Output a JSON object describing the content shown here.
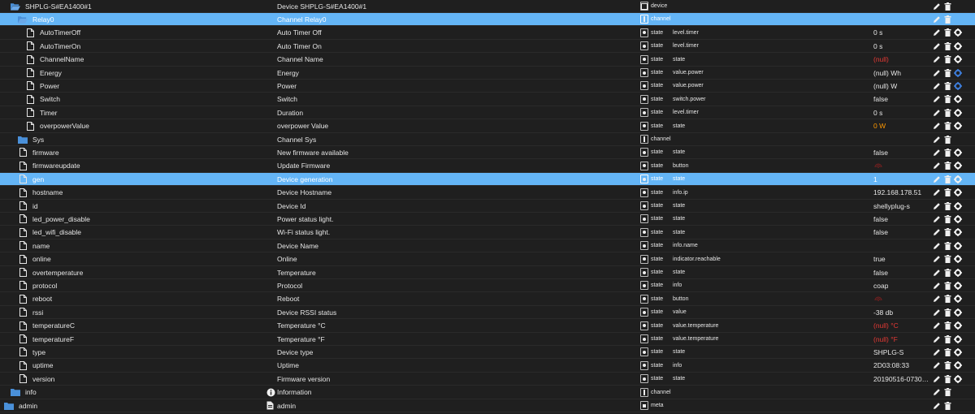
{
  "colors": {
    "background": "#1f1f1f",
    "selected_row": "#64b5f6",
    "null_value": "#e53935",
    "warn_value": "#ff9800",
    "folder": "#4a90d9"
  },
  "rows": [
    {
      "level": 0,
      "icon": "folder-open",
      "name": "SHPLG-S#EA1400#1",
      "desc": "Device SHPLG-S#EA1400#1",
      "type_icon": "device",
      "type": "device",
      "role": "",
      "value": "",
      "actions": [
        "edit",
        "delete"
      ]
    },
    {
      "level": 1,
      "icon": "folder-open",
      "name": "Relay0",
      "desc": "Channel Relay0",
      "type_icon": "channel",
      "type": "channel",
      "role": "",
      "value": "",
      "actions": [
        "edit",
        "delete"
      ],
      "selected": true
    },
    {
      "level": 2,
      "icon": "file",
      "name": "AutoTimerOff",
      "desc": "Auto Timer Off",
      "type_icon": "state",
      "type": "state",
      "role": "level.timer",
      "value": "0 s",
      "actions": [
        "edit",
        "delete",
        "gear"
      ]
    },
    {
      "level": 2,
      "icon": "file",
      "name": "AutoTimerOn",
      "desc": "Auto Timer On",
      "type_icon": "state",
      "type": "state",
      "role": "level.timer",
      "value": "0 s",
      "actions": [
        "edit",
        "delete",
        "gear"
      ]
    },
    {
      "level": 2,
      "icon": "file",
      "name": "ChannelName",
      "desc": "Channel Name",
      "type_icon": "state",
      "type": "state",
      "role": "state",
      "value": "(null)",
      "value_color": "red",
      "actions": [
        "edit",
        "delete",
        "gear"
      ]
    },
    {
      "level": 2,
      "icon": "file",
      "name": "Energy",
      "desc": "Energy",
      "type_icon": "state",
      "type": "state",
      "role": "value.power",
      "value": "(null) Wh",
      "actions": [
        "edit",
        "delete",
        "gear-blue"
      ]
    },
    {
      "level": 2,
      "icon": "file",
      "name": "Power",
      "desc": "Power",
      "type_icon": "state",
      "type": "state",
      "role": "value.power",
      "value": "(null) W",
      "actions": [
        "edit",
        "delete",
        "gear-blue"
      ]
    },
    {
      "level": 2,
      "icon": "file",
      "name": "Switch",
      "desc": "Switch",
      "type_icon": "state",
      "type": "state",
      "role": "switch.power",
      "value": "false",
      "actions": [
        "edit",
        "delete",
        "gear"
      ]
    },
    {
      "level": 2,
      "icon": "file",
      "name": "Timer",
      "desc": "Duration",
      "type_icon": "state",
      "type": "state",
      "role": "level.timer",
      "value": "0 s",
      "actions": [
        "edit",
        "delete",
        "gear"
      ]
    },
    {
      "level": 2,
      "icon": "file",
      "name": "overpowerValue",
      "desc": "overpower Value",
      "type_icon": "state",
      "type": "state",
      "role": "state",
      "value": "0 W",
      "value_color": "orange",
      "actions": [
        "edit",
        "delete",
        "gear"
      ]
    },
    {
      "level": 1,
      "icon": "folder",
      "name": "Sys",
      "desc": "Channel Sys",
      "type_icon": "channel",
      "type": "channel",
      "role": "",
      "value": "",
      "actions": [
        "edit",
        "delete"
      ]
    },
    {
      "level": 1,
      "icon": "file",
      "name": "firmware",
      "desc": "New firmware available",
      "type_icon": "state",
      "type": "state",
      "role": "state",
      "value": "false",
      "actions": [
        "edit",
        "delete",
        "gear"
      ]
    },
    {
      "level": 1,
      "icon": "file",
      "name": "firmwareupdate",
      "desc": "Update Firmware",
      "type_icon": "state",
      "type": "state",
      "role": "button",
      "value": "",
      "value_icon": "button-wave",
      "actions": [
        "edit",
        "delete",
        "gear"
      ]
    },
    {
      "level": 1,
      "icon": "file",
      "name": "gen",
      "desc": "Device generation",
      "type_icon": "state",
      "type": "state",
      "role": "state",
      "value": "1",
      "actions": [
        "edit",
        "delete",
        "gear"
      ],
      "selected": true
    },
    {
      "level": 1,
      "icon": "file",
      "name": "hostname",
      "desc": "Device Hostname",
      "type_icon": "state",
      "type": "state",
      "role": "info.ip",
      "value": "192.168.178.51",
      "actions": [
        "edit",
        "delete",
        "gear"
      ]
    },
    {
      "level": 1,
      "icon": "file",
      "name": "id",
      "desc": "Device Id",
      "type_icon": "state",
      "type": "state",
      "role": "state",
      "value": "shellyplug-s",
      "actions": [
        "edit",
        "delete",
        "gear"
      ]
    },
    {
      "level": 1,
      "icon": "file",
      "name": "led_power_disable",
      "desc": "Power status light.",
      "type_icon": "state",
      "type": "state",
      "role": "state",
      "value": "false",
      "actions": [
        "edit",
        "delete",
        "gear"
      ]
    },
    {
      "level": 1,
      "icon": "file",
      "name": "led_wifi_disable",
      "desc": "Wi-Fi status light.",
      "type_icon": "state",
      "type": "state",
      "role": "state",
      "value": "false",
      "actions": [
        "edit",
        "delete",
        "gear"
      ]
    },
    {
      "level": 1,
      "icon": "file",
      "name": "name",
      "desc": "Device Name",
      "type_icon": "state",
      "type": "state",
      "role": "info.name",
      "value": "",
      "actions": [
        "edit",
        "delete",
        "gear"
      ]
    },
    {
      "level": 1,
      "icon": "file",
      "name": "online",
      "desc": "Online",
      "type_icon": "state",
      "type": "state",
      "role": "indicator.reachable",
      "value": "true",
      "actions": [
        "edit",
        "delete",
        "gear"
      ]
    },
    {
      "level": 1,
      "icon": "file",
      "name": "overtemperature",
      "desc": "Temperature",
      "type_icon": "state",
      "type": "state",
      "role": "state",
      "value": "false",
      "actions": [
        "edit",
        "delete",
        "gear"
      ]
    },
    {
      "level": 1,
      "icon": "file",
      "name": "protocol",
      "desc": "Protocol",
      "type_icon": "state",
      "type": "state",
      "role": "info",
      "value": "coap",
      "actions": [
        "edit",
        "delete",
        "gear"
      ]
    },
    {
      "level": 1,
      "icon": "file",
      "name": "reboot",
      "desc": "Reboot",
      "type_icon": "state",
      "type": "state",
      "role": "button",
      "value": "",
      "value_icon": "button-wave",
      "actions": [
        "edit",
        "delete",
        "gear"
      ]
    },
    {
      "level": 1,
      "icon": "file",
      "name": "rssi",
      "desc": "Device RSSI status",
      "type_icon": "state",
      "type": "state",
      "role": "value",
      "value": "-38 db",
      "actions": [
        "edit",
        "delete",
        "gear"
      ]
    },
    {
      "level": 1,
      "icon": "file",
      "name": "temperatureC",
      "desc": "Temperature °C",
      "type_icon": "state",
      "type": "state",
      "role": "value.temperature",
      "value": "(null) °C",
      "value_color": "red",
      "actions": [
        "edit",
        "delete",
        "gear"
      ]
    },
    {
      "level": 1,
      "icon": "file",
      "name": "temperatureF",
      "desc": "Temperature °F",
      "type_icon": "state",
      "type": "state",
      "role": "value.temperature",
      "value": "(null) °F",
      "value_color": "red",
      "actions": [
        "edit",
        "delete",
        "gear"
      ]
    },
    {
      "level": 1,
      "icon": "file",
      "name": "type",
      "desc": "Device type",
      "type_icon": "state",
      "type": "state",
      "role": "state",
      "value": "SHPLG-S",
      "actions": [
        "edit",
        "delete",
        "gear"
      ]
    },
    {
      "level": 1,
      "icon": "file",
      "name": "uptime",
      "desc": "Uptime",
      "type_icon": "state",
      "type": "state",
      "role": "info",
      "value": "2D03:08:33",
      "actions": [
        "edit",
        "delete",
        "gear"
      ]
    },
    {
      "level": 1,
      "icon": "file",
      "name": "version",
      "desc": "Firmware version",
      "type_icon": "state",
      "type": "state",
      "role": "state",
      "value": "20190516-07302...",
      "actions": [
        "edit",
        "delete",
        "gear"
      ]
    },
    {
      "level": 0,
      "icon": "folder",
      "name": "info",
      "desc": "Information",
      "desc_icon": "info-circle",
      "type_icon": "channel",
      "type": "channel",
      "role": "",
      "value": "",
      "actions": [
        "edit",
        "delete"
      ]
    },
    {
      "level": -1,
      "icon": "folder",
      "name": "admin",
      "desc": "admin",
      "desc_icon": "file-doc",
      "type_icon": "meta",
      "type": "meta",
      "role": "",
      "value": "",
      "actions": [
        "edit",
        "delete"
      ]
    }
  ]
}
